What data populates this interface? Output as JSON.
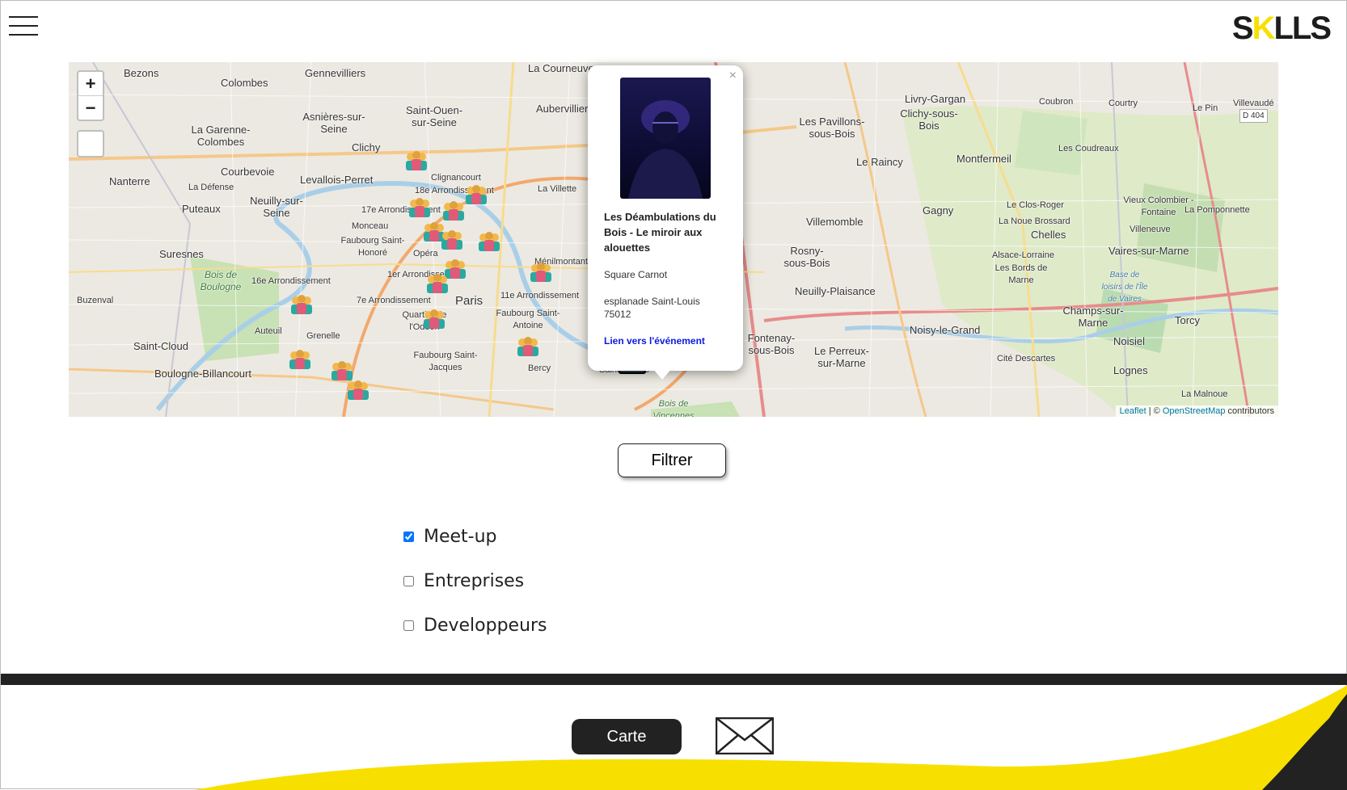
{
  "header": {
    "menu_icon": "hamburger-icon",
    "logo_parts": [
      "S",
      "K",
      "LLS"
    ]
  },
  "map": {
    "zoom_in": "+",
    "zoom_out": "−",
    "layers_icon": "layers-icon",
    "labels": [
      "Bezons",
      "Colombes",
      "Gennevilliers",
      "La Courneuve",
      "Saint-Ouen-sur-Seine",
      "Aubervilliers",
      "Asnières-sur-Seine",
      "La Garenne-Colombes",
      "Clichy",
      "Courbevoie",
      "Levallois-Perret",
      "Nanterre",
      "La Défense",
      "Neuilly-sur-Seine",
      "Puteaux",
      "Clignancourt",
      "18e Arrondissement",
      "La Villette",
      "17e Arrondissement",
      "Monceau",
      "Faubourg Saint-Honoré",
      "Opéra",
      "Suresnes",
      "Bois de Boulogne",
      "16e Arrondissement",
      "1er Arrondissement",
      "Paris",
      "7e Arrondissement",
      "11e Arrondissement",
      "Ménilmontant",
      "Faubourg Saint-Antoine",
      "Quartier de l'Odéon",
      "Grenelle",
      "Auteuil",
      "Buzenval",
      "Saint-Cloud",
      "Boulogne-Billancourt",
      "Faubourg Saint-Jacques",
      "Bercy",
      "Livry-Gargan",
      "Clichy-sous-Bois",
      "Les Pavillons-sous-Bois",
      "Le Raincy",
      "Montfermeil",
      "Coubron",
      "Courtry",
      "Le Pin",
      "Villevaudé",
      "Les Coudreaux",
      "Le Clos-Roger",
      "Vieux Colombier - Fontaine",
      "La Pomponnette",
      "Gagny",
      "Villemomble",
      "La Noue Brossard",
      "Chelles",
      "Villeneuve",
      "Vaires-sur-Marne",
      "Rosny-sous-Bois",
      "Neuilly-Plaisance",
      "Alsace-Lorraine",
      "Les Bords de Marne",
      "Base de loisirs de l'Île de Vaires",
      "Noisy-le-Grand",
      "Champs-sur-Marne",
      "Torcy",
      "Noisiel",
      "Le Perreux-sur-Marne",
      "Cité Descartes",
      "Lognes",
      "La Malnoue",
      "Bois de Vincennes",
      "D 404",
      "Fontenay-sous-Bois",
      "Saint-Mandé"
    ],
    "attribution": {
      "leaflet": "Leaflet",
      "separator": " | © ",
      "osm": "OpenStreetMap",
      "suffix": " contributors"
    },
    "marker_icon": "meetup-group-icon"
  },
  "popup": {
    "close": "×",
    "title": "Les Déambulations du Bois - Le miroir aux alouettes",
    "place": "Square Carnot",
    "address": "esplanade Saint-Louis 75012",
    "link": "Lien vers l'événement"
  },
  "filter_button": "Filtrer",
  "filters": [
    {
      "label": "Meet-up",
      "checked": true
    },
    {
      "label": "Entreprises",
      "checked": false
    },
    {
      "label": "Developpeurs",
      "checked": false
    }
  ],
  "footer": {
    "carte_button": "Carte",
    "mail_icon": "envelope-icon"
  },
  "colors": {
    "accent": "#f7e000",
    "dark": "#222222",
    "link": "#0b1bdd"
  }
}
